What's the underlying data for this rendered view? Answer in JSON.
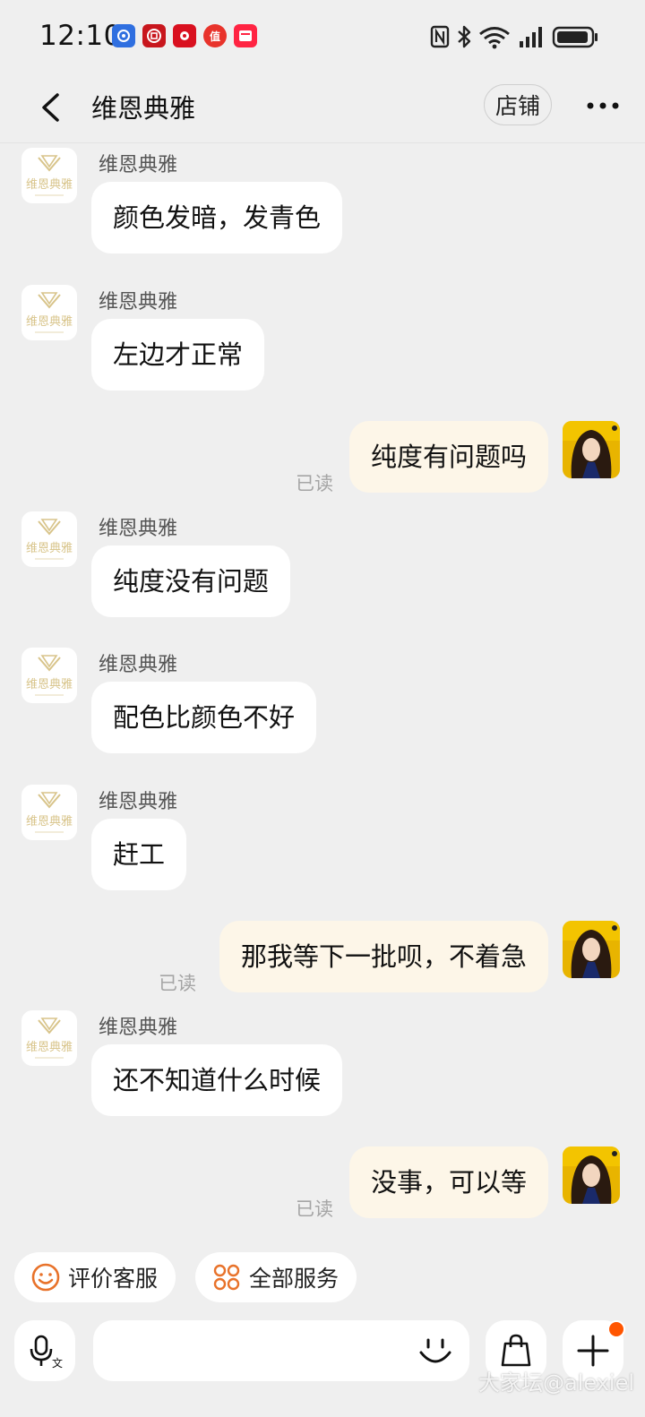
{
  "status_bar": {
    "time": "12:10",
    "notification_icons": [
      "app-blue-icon",
      "bank-icon",
      "red-app-icon",
      "deal-app-icon",
      "red-book-icon"
    ],
    "system_icons": [
      "nfc-icon",
      "bluetooth-icon",
      "wifi-icon",
      "signal-icon",
      "battery-icon"
    ],
    "deal_icon_text": "值"
  },
  "header": {
    "title": "维恩典雅",
    "shop_button": "店铺"
  },
  "store_logo": {
    "text": "维恩典雅",
    "color": "#d8c48a"
  },
  "messages": [
    {
      "from": "store",
      "sender": "维恩典雅",
      "text": "颜色发暗，发青色"
    },
    {
      "from": "store",
      "sender": "维恩典雅",
      "text": "左边才正常"
    },
    {
      "from": "me",
      "text": "纯度有问题吗",
      "status": "已读"
    },
    {
      "from": "store",
      "sender": "维恩典雅",
      "text": "纯度没有问题"
    },
    {
      "from": "store",
      "sender": "维恩典雅",
      "text": "配色比颜色不好"
    },
    {
      "from": "store",
      "sender": "维恩典雅",
      "text": "赶工"
    },
    {
      "from": "me",
      "text": "那我等下一批呗，不着急",
      "status": "已读"
    },
    {
      "from": "store",
      "sender": "维恩典雅",
      "text": "还不知道什么时候"
    },
    {
      "from": "me",
      "text": "没事，可以等",
      "status": "已读"
    }
  ],
  "quick_actions": [
    {
      "label": "评价客服",
      "icon": "smile-icon"
    },
    {
      "label": "全部服务",
      "icon": "grid-icon"
    }
  ],
  "input_bar": {
    "value": "",
    "placeholder": "",
    "voice_icon_text": "文"
  },
  "watermark": "大家坛@alexiel",
  "colors": {
    "background": "#efefef",
    "outgoing_bubble": "#fdf6e8",
    "incoming_bubble": "#ffffff",
    "accent_orange": "#ff5500",
    "action_icon": "#e8722a"
  }
}
